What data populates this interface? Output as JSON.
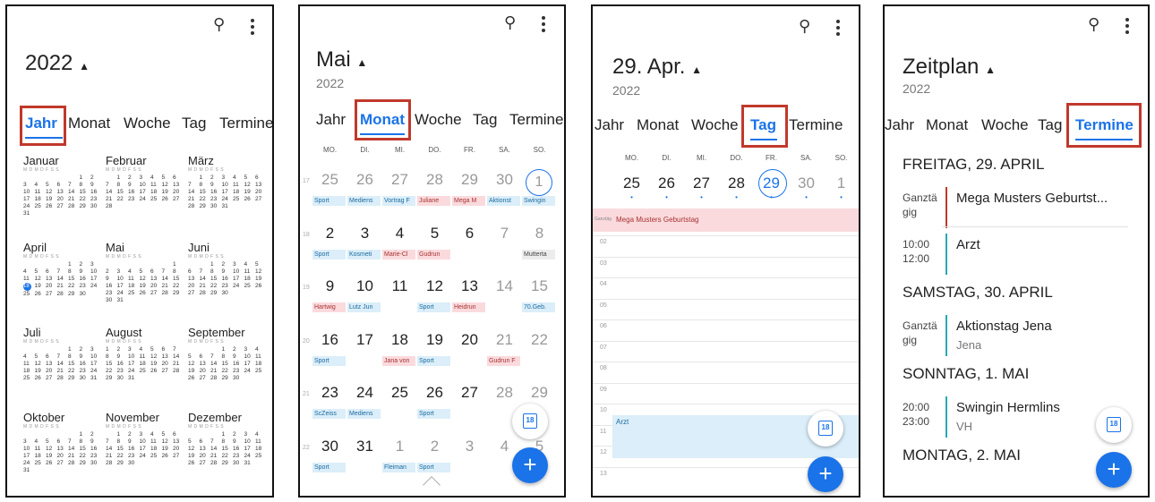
{
  "colors": {
    "accent": "#1a73e8",
    "highlight_box": "#c0392b",
    "event_blue": "#dbeef9",
    "event_red": "#fadadd"
  },
  "icons": {
    "search": "search-icon",
    "menu": "more-vert-icon",
    "today": "calendar-today-icon",
    "add": "add-icon",
    "expand": "chevron-up-icon",
    "dropdown": "caret-up-icon"
  },
  "tab_labels": {
    "year": "Jahr",
    "month": "Monat",
    "week": "Woche",
    "day": "Tag",
    "agenda": "Termine"
  },
  "today_button_label": "18",
  "screen1": {
    "title": "2022",
    "active_tab": "Jahr",
    "months": [
      {
        "name": "Januar",
        "dh": "M D M D F S S",
        "rows": [
          "         1 2",
          "3 4 5 6 7 8 9",
          "10 11 12 13 14 15 16",
          "17 18 19 20 21 22 23",
          "24 25 26 27 28 29 30",
          "31"
        ]
      },
      {
        "name": "Februar",
        "dh": "M D M D F S S",
        "rows": [
          "  1 2 3 4 5 6",
          "7 8 9 10 11 12 13",
          "14 15 16 17 18 19 20",
          "21 22 23 24 25 26 27",
          "28"
        ]
      },
      {
        "name": "März",
        "dh": "M D M D F S S",
        "rows": [
          "  1 2 3 4 5 6",
          "7 8 9 10 11 12 13",
          "14 15 16 17 18 19 20",
          "21 22 23 24 25 26 27",
          "28 29 30 31"
        ]
      },
      {
        "name": "April",
        "dh": "M D M D F S S",
        "rows": [
          "      1 2 3",
          "4 5 6 7 8 9 10",
          "11 12 13 14 15 16 17",
          "18 19 20 21 22 23 24",
          "25 26 27 28 29 30"
        ]
      },
      {
        "name": "Mai",
        "dh": "M D M D F S S",
        "rows": [
          "            1",
          "2 3 4 5 6 7 8",
          "9 10 11 12 13 14 15",
          "16 17 18 19 20 21 22",
          "23 24 25 26 27 28 29",
          "30 31"
        ]
      },
      {
        "name": "Juni",
        "dh": "M D M D F S S",
        "rows": [
          "    1 2 3 4 5",
          "6 7 8 9 10 11 12",
          "13 14 15 16 17 18 19",
          "20 21 22 23 24 25 26",
          "27 28 29 30"
        ]
      },
      {
        "name": "Juli",
        "dh": "M D M D F S S",
        "rows": [
          "        1 2 3",
          "4 5 6 7 8 9 10",
          "11 12 13 14 15 16 17",
          "18 19 20 21 22 23 24",
          "25 26 27 28 29 30 31"
        ]
      },
      {
        "name": "August",
        "dh": "M D M D F S S",
        "rows": [
          "1 2 3 4 5 6 7",
          "8 9 10 11 12 13 14",
          "15 16 17 18 19 20 21",
          "22 23 24 25 26 27 28",
          "29 30 31"
        ]
      },
      {
        "name": "September",
        "dh": "M D M D F S S",
        "rows": [
          "      1 2 3 4",
          "5 6 7 8 9 10 11",
          "12 13 14 15 16 17 18",
          "19 20 21 22 23 24 25",
          "26 27 28 29 30"
        ]
      },
      {
        "name": "Oktober",
        "dh": "M D M D F S S",
        "rows": [
          "          1 2",
          "3 4 5 6 7 8 9",
          "10 11 12 13 14 15 16",
          "17 18 19 20 21 22 23",
          "24 25 26 27 28 29 30",
          "31"
        ]
      },
      {
        "name": "November",
        "dh": "M D M D F S S",
        "rows": [
          "  1 2 3 4 5 6",
          "7 8 9 10 11 12 13",
          "14 15 16 17 18 19 20",
          "21 22 23 24 25 26 27",
          "28 29 30"
        ]
      },
      {
        "name": "Dezember",
        "dh": "M D M D F S S",
        "rows": [
          "      1 2 3 4",
          "5 6 7 8 9 10 11",
          "12 13 14 15 16 17 18",
          "19 20 21 22 23 24 25",
          "26 27 28 29 30 31"
        ]
      }
    ]
  },
  "screen2": {
    "title": "Mai",
    "subtitle": "2022",
    "active_tab": "Monat",
    "weekday_headers": [
      "MO.",
      "DI.",
      "MI.",
      "DO.",
      "FR.",
      "SA.",
      "SO."
    ],
    "weeks": [
      {
        "wk": "17",
        "days": [
          "25",
          "26",
          "27",
          "28",
          "29",
          "30",
          "1"
        ],
        "events": [
          [
            "Sport",
            "b"
          ],
          [
            "Mediens",
            "b"
          ],
          [
            "Vortrag F",
            "b"
          ],
          [
            "Juliane",
            "r"
          ],
          [
            "Mega M",
            "r"
          ],
          [
            "Aktionst",
            "b"
          ],
          [
            "Swingin",
            "b"
          ]
        ]
      },
      {
        "wk": "18",
        "days": [
          "2",
          "3",
          "4",
          "5",
          "6",
          "7",
          "8"
        ],
        "events": [
          [
            "Sport",
            "b"
          ],
          [
            "Kosmeti",
            "b"
          ],
          [
            "Marie-Cl",
            "r"
          ],
          [
            "Gudrun",
            "r"
          ],
          [
            "",
            ""
          ],
          [
            "",
            ""
          ],
          [
            "Mutterta",
            "g"
          ]
        ]
      },
      {
        "wk": "19",
        "days": [
          "9",
          "10",
          "11",
          "12",
          "13",
          "14",
          "15"
        ],
        "events": [
          [
            "Hartwig",
            "r"
          ],
          [
            "Lutz Jun",
            "b"
          ],
          [
            "",
            ""
          ],
          [
            "Sport",
            "b"
          ],
          [
            "Heidrun",
            "r"
          ],
          [
            "",
            ""
          ],
          [
            "70.Geb.",
            "b"
          ]
        ]
      },
      {
        "wk": "20",
        "days": [
          "16",
          "17",
          "18",
          "19",
          "20",
          "21",
          "22"
        ],
        "events": [
          [
            "Sport",
            "b"
          ],
          [
            "",
            ""
          ],
          [
            "Jana von",
            "r"
          ],
          [
            "Sport",
            "b"
          ],
          [
            "",
            ""
          ],
          [
            "Gudrun F",
            "r"
          ],
          [
            "",
            ""
          ]
        ]
      },
      {
        "wk": "21",
        "days": [
          "23",
          "24",
          "25",
          "26",
          "27",
          "28",
          "29"
        ],
        "events": [
          [
            "ScZeiss",
            "b"
          ],
          [
            "Mediens",
            "b"
          ],
          [
            "",
            ""
          ],
          [
            "Sport",
            "b"
          ],
          [
            "",
            ""
          ],
          [
            "",
            ""
          ],
          [
            "",
            ""
          ]
        ]
      },
      {
        "wk": "22",
        "days": [
          "30",
          "31",
          "1",
          "2",
          "3",
          "4",
          "5"
        ],
        "events": [
          [
            "Sport",
            "b"
          ],
          [
            "",
            ""
          ],
          [
            "Fleiman",
            "b"
          ],
          [
            "Sport",
            "b"
          ],
          [
            "",
            ""
          ],
          [
            "",
            ""
          ],
          [
            "",
            ""
          ]
        ]
      }
    ]
  },
  "screen3": {
    "title": "29. Apr.",
    "subtitle": "2022",
    "active_tab": "Tag",
    "weekday_headers": [
      "MO.",
      "DI.",
      "MI.",
      "DO.",
      "FR.",
      "SA.",
      "SO."
    ],
    "days": [
      "25",
      "26",
      "27",
      "28",
      "29",
      "30",
      "1"
    ],
    "allday_label": "Ganztäg",
    "allday_event": "Mega Musters Geburtstag",
    "hours": [
      "02",
      "03",
      "04",
      "05",
      "06",
      "07",
      "08",
      "09",
      "10",
      "11",
      "12",
      "13"
    ],
    "timed_event": "Arzt"
  },
  "screen4": {
    "title": "Zeitplan",
    "subtitle": "2022",
    "active_tab": "Termine",
    "groups": [
      {
        "heading": "FREITAG, 29. APRIL",
        "items": [
          {
            "time1": "Ganztä",
            "time2": "gig",
            "title": "Mega Musters Geburtst...",
            "loc": "",
            "color": "#c0392b"
          },
          {
            "time1": "10:00",
            "time2": "12:00",
            "title": "Arzt",
            "loc": "",
            "color": "#2aa7b8"
          }
        ]
      },
      {
        "heading": "SAMSTAG, 30. APRIL",
        "items": [
          {
            "time1": "Ganztä",
            "time2": "gig",
            "title": "Aktionstag Jena",
            "loc": "Jena",
            "color": "#2aa7b8"
          }
        ]
      },
      {
        "heading": "SONNTAG, 1. MAI",
        "items": [
          {
            "time1": "20:00",
            "time2": "23:00",
            "title": "Swingin Hermlins",
            "loc": "VH",
            "color": "#2aa7b8"
          }
        ]
      },
      {
        "heading": "MONTAG, 2. MAI",
        "items": []
      }
    ]
  }
}
